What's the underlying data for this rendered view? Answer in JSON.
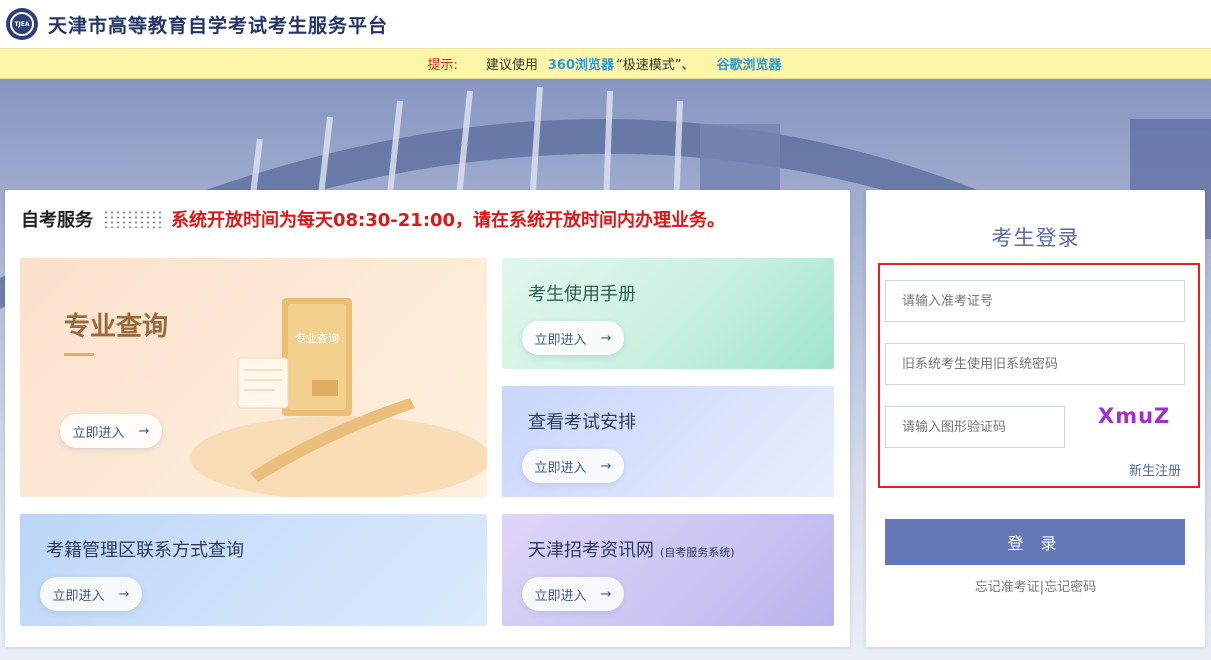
{
  "header": {
    "logo_text": "TJEA",
    "title": "天津市高等教育自学考试考生服务平台"
  },
  "tip": {
    "label": "提示:",
    "text": "建议使用",
    "browser1": "360浏览器",
    "mode": "“极速模式”、",
    "browser2": "谷歌浏览器"
  },
  "services": {
    "title": "自考服务",
    "notice": "系统开放时间为每天08:30-21:00，请在系统开放时间内办理业务。",
    "cards": [
      {
        "title": "专业查询",
        "book_label": "专业查询",
        "button": "立即进入",
        "arrow": "→"
      },
      {
        "title": "考生使用手册",
        "button": "立即进入",
        "arrow": "→"
      },
      {
        "title": "查看考试安排",
        "button": "立即进入",
        "arrow": "→"
      },
      {
        "title": "考籍管理区联系方式查询",
        "button": "立即进入",
        "arrow": "→"
      },
      {
        "title": "天津招考资讯网",
        "subtitle": "(自考服务系统)",
        "button": "立即进入",
        "arrow": "→"
      }
    ]
  },
  "login": {
    "title": "考生登录",
    "id_placeholder": "请输入准考证号",
    "pwd_placeholder": "旧系统考生使用旧系统密码",
    "captcha_placeholder": "请输入图形验证码",
    "captcha_text": "XmuZ",
    "register": "新生注册",
    "submit": "登 录",
    "forgot_id": "忘记准考证",
    "sep": "|",
    "forgot_pwd": "忘记密码"
  }
}
